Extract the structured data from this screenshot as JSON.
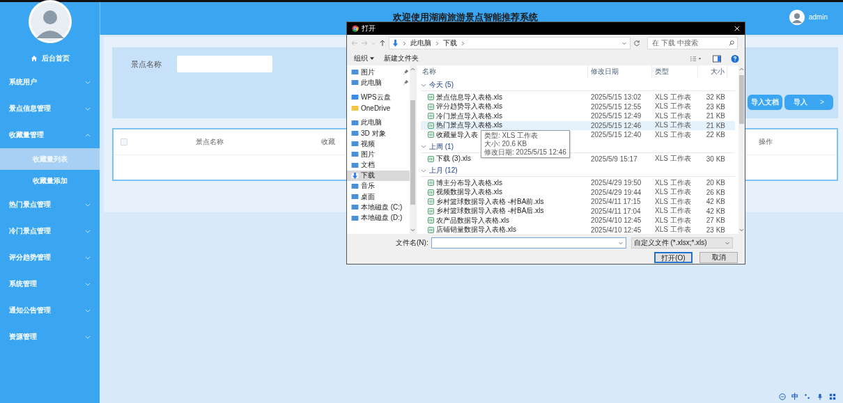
{
  "header": {
    "title": "欢迎使用湖南旅游景点智能推荐系统",
    "user": "admin"
  },
  "sidebar": {
    "home": "后台首页",
    "menus": [
      {
        "label": "系统用户",
        "expanded": false
      },
      {
        "label": "景点信息管理",
        "expanded": false
      },
      {
        "label": "收藏量管理",
        "expanded": true,
        "children": [
          {
            "label": "收藏量列表",
            "selected": true
          },
          {
            "label": "收藏量添加",
            "selected": false
          }
        ]
      },
      {
        "label": "热门景点管理",
        "expanded": false
      },
      {
        "label": "冷门景点管理",
        "expanded": false
      },
      {
        "label": "评分趋势管理",
        "expanded": false
      },
      {
        "label": "系统管理",
        "expanded": false
      },
      {
        "label": "通知公告管理",
        "expanded": false
      },
      {
        "label": "资源管理",
        "expanded": false
      }
    ]
  },
  "search": {
    "label": "景点名称"
  },
  "buttons": [
    {
      "label": "导入文档"
    },
    {
      "label": "导入",
      "icon": ">"
    }
  ],
  "table": {
    "select_all": {
      "checked": false
    },
    "columns": [
      "景点名称",
      "收藏",
      "操作"
    ]
  },
  "dialog": {
    "title": "打开",
    "path": [
      "此电脑",
      "下载"
    ],
    "search_placeholder": "在 下载 中搜索",
    "toolbar": [
      "组织",
      "新建文件夹"
    ],
    "nav": [
      {
        "label": "图片",
        "selected": false,
        "pinned": true
      },
      {
        "label": "此电脑",
        "selected": false,
        "pinned": true
      },
      {
        "label": "WPS云盘",
        "selected": false,
        "pinned": false
      },
      {
        "label": "OneDrive",
        "selected": false,
        "pinned": false
      },
      {
        "label": "此电脑",
        "selected": false,
        "pinned": false
      },
      {
        "label": "3D 对象",
        "selected": false,
        "pinned": false
      },
      {
        "label": "视频",
        "selected": false,
        "pinned": false
      },
      {
        "label": "图片",
        "selected": false,
        "pinned": false
      },
      {
        "label": "文档",
        "selected": false,
        "pinned": false
      },
      {
        "label": "下载",
        "selected": true,
        "pinned": false
      },
      {
        "label": "音乐",
        "selected": false,
        "pinned": false
      },
      {
        "label": "桌面",
        "selected": false,
        "pinned": false
      },
      {
        "label": "本地磁盘 (C:)",
        "selected": false,
        "pinned": false
      },
      {
        "label": "本地磁盘 (D:)",
        "selected": false,
        "pinned": false
      }
    ],
    "columns": [
      "名称",
      "修改日期",
      "类型",
      "大小"
    ],
    "groups": [
      {
        "label": "今天 (5)",
        "expanded": true,
        "files": [
          {
            "name": "景点信息导入表格.xls",
            "date": "2025/5/15 13:02",
            "type": "XLS 工作表",
            "size": "32 KB",
            "selected": false
          },
          {
            "name": "评分趋势导入表格.xls",
            "date": "2025/5/15 12:55",
            "type": "XLS 工作表",
            "size": "23 KB",
            "selected": false
          },
          {
            "name": "冷门景点导入表格.xls",
            "date": "2025/5/15 12:49",
            "type": "XLS 工作表",
            "size": "21 KB",
            "selected": false
          },
          {
            "name": "热门景点导入表格.xls",
            "date": "2025/5/15 12:46",
            "type": "XLS 工作表",
            "size": "21 KB",
            "selected": true
          },
          {
            "name": "收藏量导入表",
            "date": "2025/5/15 12:40",
            "type": "XLS 工作表",
            "size": "22 KB",
            "selected": false
          }
        ]
      },
      {
        "label": "上周 (1)",
        "expanded": true,
        "files": [
          {
            "name": "下载 (3).xls",
            "date": "2025/5/9 15:17",
            "type": "XLS 工作表",
            "size": "30 KB",
            "selected": false
          }
        ]
      },
      {
        "label": "上月 (12)",
        "expanded": true,
        "files": [
          {
            "name": "博主分布导入表格.xls",
            "date": "2025/4/29 19:50",
            "type": "XLS 工作表",
            "size": "20 KB",
            "selected": false
          },
          {
            "name": "视频数据导入表格.xls",
            "date": "2025/4/29 19:44",
            "type": "XLS 工作表",
            "size": "26 KB",
            "selected": false
          },
          {
            "name": "乡村篮球数据导入表格 -村BA前.xls",
            "date": "2025/4/11 17:15",
            "type": "XLS 工作表",
            "size": "42 KB",
            "selected": false
          },
          {
            "name": "乡村篮球数据导入表格 -村BA后.xls",
            "date": "2025/4/11 17:04",
            "type": "XLS 工作表",
            "size": "42 KB",
            "selected": false
          },
          {
            "name": "农产品数据导入表格.xls",
            "date": "2025/4/10 12:45",
            "type": "XLS 工作表",
            "size": "27 KB",
            "selected": false
          },
          {
            "name": "店铺销量数据导入表格.xls",
            "date": "2025/4/10 12:45",
            "type": "XLS 工作表",
            "size": "23 KB",
            "selected": false
          }
        ]
      }
    ],
    "tooltip": [
      "类型: XLS 工作表",
      "大小: 20.6 KB",
      "修改日期: 2025/5/15 12:46"
    ],
    "filename_label": "文件名(N):",
    "filter": "自定义文件 (*.xlsx;*.xls)",
    "buttons": [
      "打开(O)",
      "取消"
    ]
  },
  "tray": {
    "ime": "中"
  }
}
